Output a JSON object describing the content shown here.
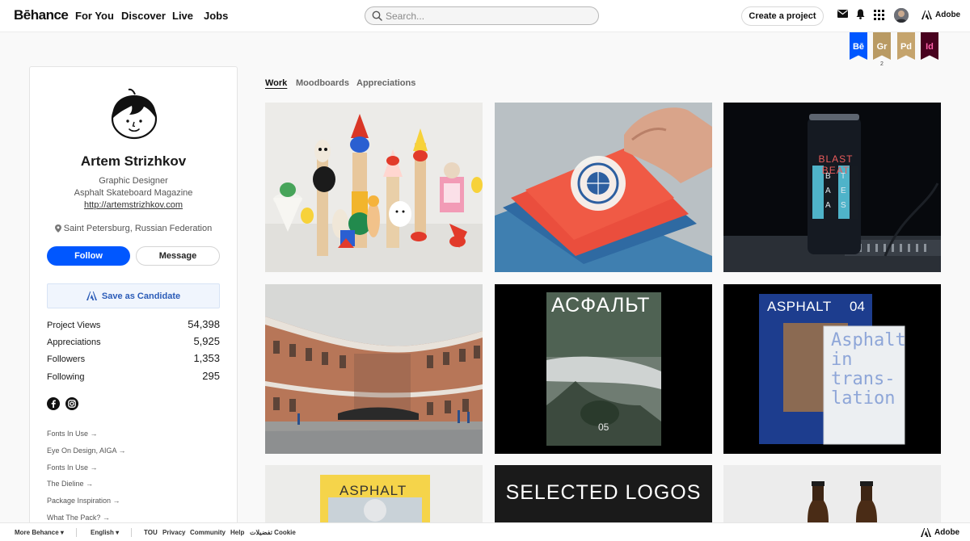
{
  "nav": {
    "logo": "Bēhance",
    "links": [
      "For You",
      "Discover",
      "Live",
      "Jobs"
    ],
    "search_placeholder": "Search...",
    "create_label": "Create a project",
    "adobe_label": "Adobe"
  },
  "badges": [
    {
      "label": "Bē",
      "color": "#0057ff"
    },
    {
      "label": "Gr",
      "color": "#b99a63",
      "count": "2"
    },
    {
      "label": "Pd",
      "color": "#c5a46d"
    },
    {
      "label": "Id",
      "color": "#49021f"
    }
  ],
  "profile": {
    "name": "Artem Strizhkov",
    "title": "Graphic Designer",
    "company": "Asphalt Skateboard Magazine",
    "website": "http://artemstrizhkov.com",
    "location": "Saint Petersburg, Russian Federation",
    "follow_label": "Follow",
    "message_label": "Message",
    "candidate_label": "Save as Candidate",
    "stats": [
      {
        "label": "Project Views",
        "value": "54,398"
      },
      {
        "label": "Appreciations",
        "value": "5,925"
      },
      {
        "label": "Followers",
        "value": "1,353"
      },
      {
        "label": "Following",
        "value": "295"
      }
    ],
    "links": [
      "Fonts In Use →",
      "Eye On Design, AIGA →",
      "Fonts In Use →",
      "The Dieline →",
      "Package Inspiration →",
      "What The Pack? →"
    ]
  },
  "tabs": [
    "Work",
    "Moodboards",
    "Appreciations"
  ],
  "projects": {
    "can_text": "BLAST BEAT",
    "can_letters": [
      "B",
      "E",
      "A",
      "S",
      "A",
      "T"
    ],
    "asfalt_title": "АСФАЛЬТ",
    "asfalt_number": "05",
    "asphalt_title": "ASPHALT",
    "asphalt_number": "04",
    "translation_text": [
      "Asphalt",
      "in",
      "trans-",
      "lation"
    ],
    "asphalt_yellow_title": "ASPHALT",
    "logos_title": "SELECTED LOGOS"
  },
  "footer": {
    "more": "More Behance",
    "language": "English",
    "links": [
      "TOU",
      "Privacy",
      "Community",
      "Help",
      "تفضيلات Cookie"
    ],
    "adobe_label": "Adobe"
  },
  "colors": {
    "accent": "#0057ff",
    "candidate_text": "#2b5cb8"
  }
}
